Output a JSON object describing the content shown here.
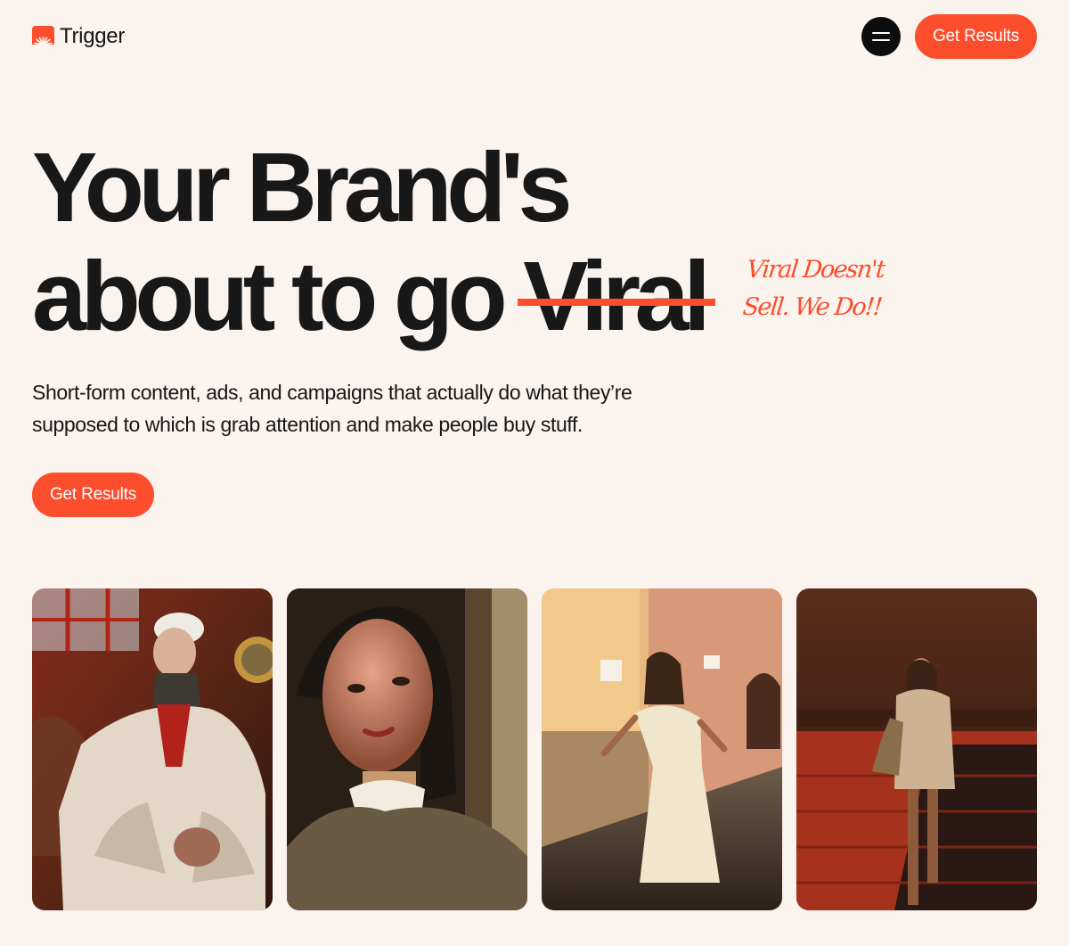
{
  "header": {
    "brand": "Trigger",
    "cta_label": "Get Results"
  },
  "hero": {
    "headline_line1": "Your Brand's",
    "headline_line2_prefix": "about to go ",
    "headline_struck_word": "Viral",
    "note_line1": "Viral Doesn't",
    "note_line2": "Sell. We Do!!",
    "subtext": "Short-form content, ads, and campaigns that actually do what they’re supposed to which is grab attention and make people buy stuff.",
    "cta_label": "Get Results"
  },
  "colors": {
    "accent": "#fc4d2c",
    "background": "#fbf3ee",
    "text": "#141414"
  },
  "icons": {
    "logo": "sunburst-logo-icon",
    "menu": "hamburger-menu-icon"
  }
}
